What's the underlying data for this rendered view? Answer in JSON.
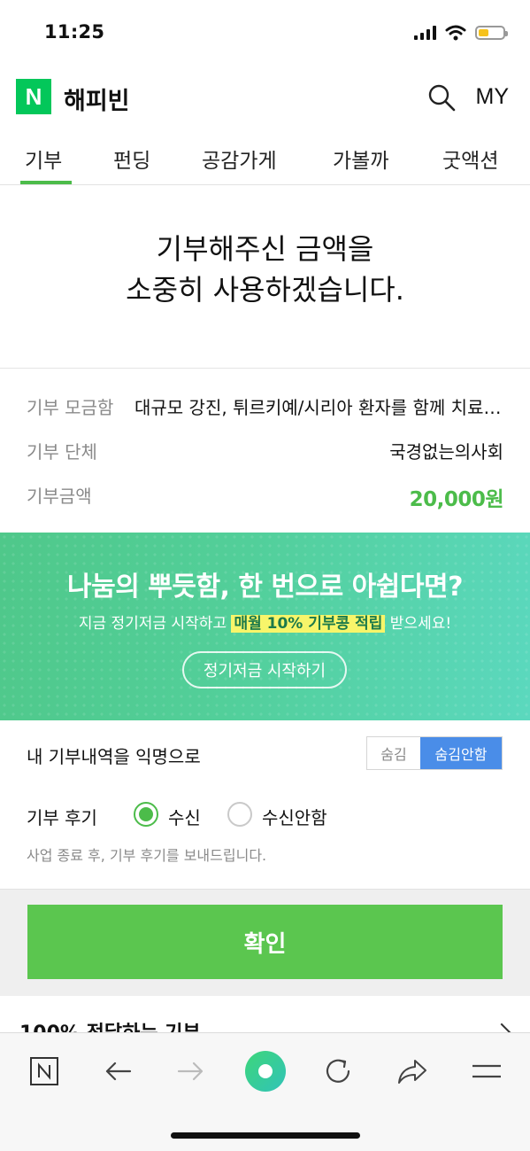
{
  "status_bar": {
    "time": "11:25"
  },
  "header": {
    "logo_letter": "N",
    "brand": "해피빈",
    "my": "MY"
  },
  "tabs": [
    {
      "label": "기부",
      "active": true
    },
    {
      "label": "펀딩"
    },
    {
      "label": "공감가게"
    },
    {
      "label": "가볼까"
    },
    {
      "label": "굿액션"
    }
  ],
  "thanks": {
    "line1": "기부해주신 금액을",
    "line2": "소중히 사용하겠습니다."
  },
  "info": {
    "campaign_label": "기부 모금함",
    "campaign_value": "대규모 강진, 튀르키예/시리아 환자를 함께 치료해…",
    "org_label": "기부 단체",
    "org_value": "국경없는의사회",
    "amount_label": "기부금액",
    "amount_value": "20,000원"
  },
  "banner": {
    "title": "나눔의 뿌듯함, 한 번으로 아쉽다면?",
    "sub_before": "지금 정기저금 시작하고 ",
    "sub_highlight": "매월 10% 기부콩 적립",
    "sub_after": " 받으세요!",
    "button": "정기저금 시작하기"
  },
  "anonymous": {
    "label": "내 기부내역을 익명으로",
    "option_hide": "숨김",
    "option_show": "숨김안함",
    "selected": "숨김안함"
  },
  "review": {
    "label": "기부 후기",
    "option_receive": "수신",
    "option_decline": "수신안함",
    "selected": "수신",
    "hint": "사업 종료 후, 기부 후기를 보내드립니다."
  },
  "confirm": {
    "label": "확인"
  },
  "next_section": {
    "title": "100% 전달하는 기부"
  },
  "colors": {
    "brand_green": "#03c75a",
    "accent_green": "#4cbc4a",
    "confirm_green": "#5bc64f",
    "toggle_blue": "#4a8de8"
  },
  "toolbar": {
    "icons": [
      "naver-home-icon",
      "back-arrow-icon",
      "forward-arrow-icon",
      "green-dot-icon",
      "refresh-icon",
      "share-icon",
      "menu-icon"
    ]
  }
}
